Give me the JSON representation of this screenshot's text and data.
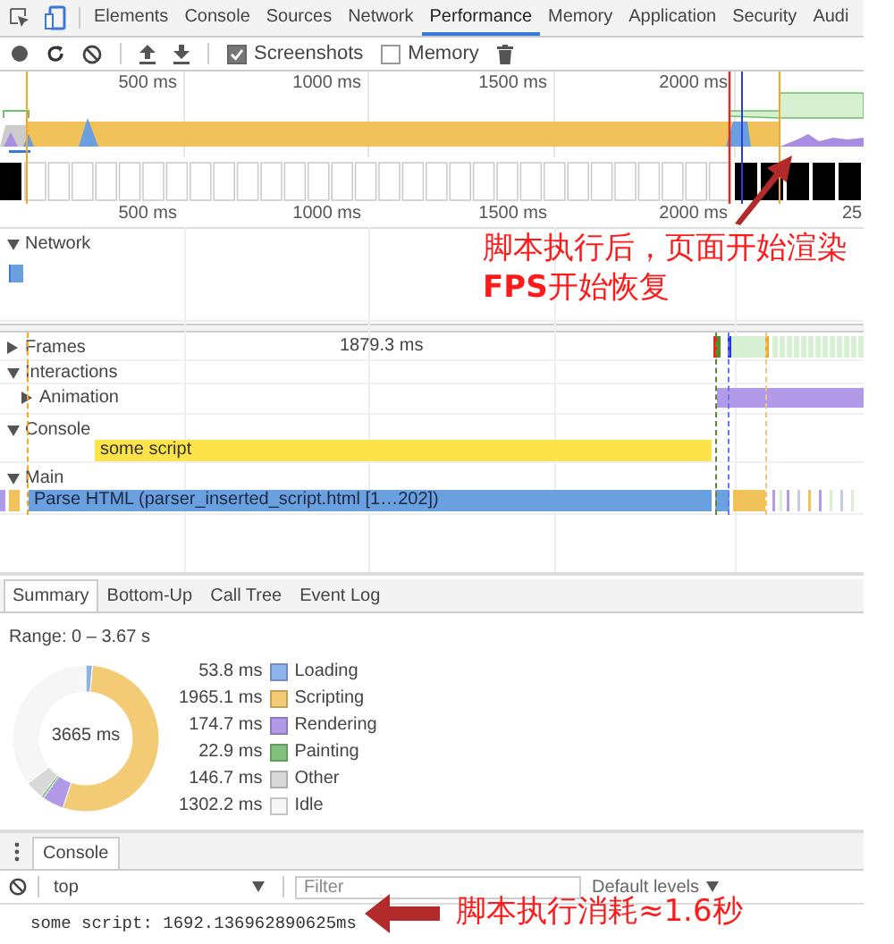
{
  "tabs": [
    {
      "label": "Elements",
      "selected": false
    },
    {
      "label": "Console",
      "selected": false
    },
    {
      "label": "Sources",
      "selected": false
    },
    {
      "label": "Network",
      "selected": false
    },
    {
      "label": "Performance",
      "selected": true
    },
    {
      "label": "Memory",
      "selected": false
    },
    {
      "label": "Application",
      "selected": false
    },
    {
      "label": "Security",
      "selected": false
    },
    {
      "label": "Audi",
      "selected": false
    }
  ],
  "toolbar": {
    "checkboxes": [
      {
        "label": "Screenshots",
        "checked": true
      },
      {
        "label": "Memory",
        "checked": false
      }
    ]
  },
  "overview": {
    "ticks": [
      "500 ms",
      "1000 ms",
      "1500 ms",
      "2000 ms"
    ]
  },
  "ruler": {
    "ticks": [
      "500 ms",
      "1000 ms",
      "1500 ms",
      "2000 ms",
      "25"
    ]
  },
  "network": {
    "label": "Network",
    "expanded": true
  },
  "tracks": [
    {
      "kind": "frames",
      "label": "Frames",
      "expanded": false,
      "duration": "1879.3 ms"
    },
    {
      "kind": "group",
      "label": "Interactions",
      "expanded": true,
      "children": [
        {
          "label": "Animation",
          "expanded": false
        }
      ]
    },
    {
      "kind": "console",
      "label": "Console",
      "expanded": true,
      "bar": "some script"
    },
    {
      "kind": "main",
      "label": "Main",
      "expanded": true,
      "bar": "Parse HTML (parser_inserted_script.html [1…202])"
    }
  ],
  "summary": {
    "tabs": [
      {
        "label": "Summary",
        "selected": true
      },
      {
        "label": "Bottom-Up",
        "selected": false
      },
      {
        "label": "Call Tree",
        "selected": false
      },
      {
        "label": "Event Log",
        "selected": false
      }
    ],
    "range": "Range: 0 – 3.67 s",
    "total": "3665 ms",
    "legend": [
      {
        "value": "53.8 ms",
        "color": "#8cb4e8"
      },
      {
        "value": "1965.1 ms",
        "color": "#f2cb74"
      },
      {
        "value": "174.7 ms",
        "color": "#b19ae8"
      },
      {
        "value": "22.9 ms",
        "color": "#80c27c"
      },
      {
        "value": "146.7 ms",
        "color": "#d9d9d9"
      },
      {
        "value": "1302.2 ms",
        "color": "#f6f6f6"
      }
    ],
    "chart_data": {
      "type": "donut",
      "categories": [
        "Loading",
        "Scripting",
        "Rendering",
        "Painting",
        "Other",
        "Idle"
      ],
      "values": [
        1.47,
        53.61,
        4.77,
        0.62,
        4.0,
        35.53
      ]
    }
  },
  "console": {
    "tabs": [
      {
        "label": "Console",
        "selected": true
      }
    ],
    "context": "top",
    "filter": {
      "placeholder": "Filter"
    },
    "levels": "Default levels",
    "messages": [
      "some script: 1692.136962890625ms"
    ]
  },
  "annotations": [
    {
      "kind": "top",
      "text": "脚本执行后，页面开始渲染"
    },
    {
      "kind": "top",
      "text": "**FPS**开始恢复"
    },
    {
      "kind": "bottom",
      "text": "脚本执行消耗≈1.6秒"
    }
  ]
}
